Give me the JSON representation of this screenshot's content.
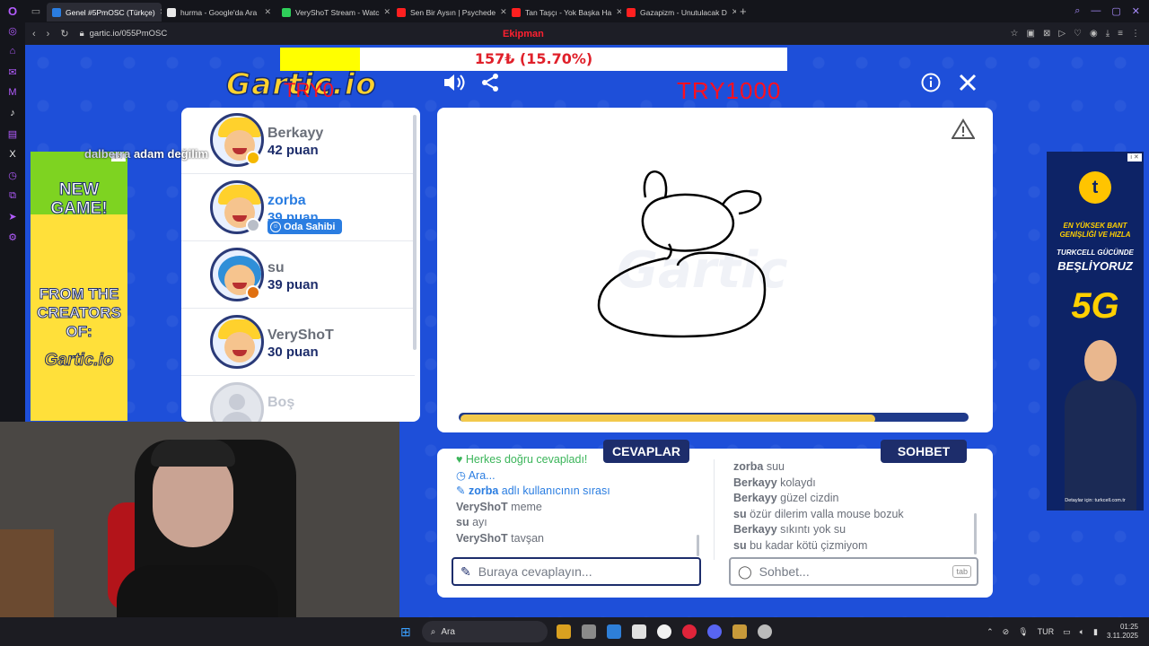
{
  "browser": {
    "tabs": [
      {
        "title": "Genel #5PmOSC (Türkçe)",
        "active": true,
        "color": "#2a7de1"
      },
      {
        "title": "hurma - Google'da Ara",
        "active": false,
        "color": "#e8e8e8"
      },
      {
        "title": "VeryShoT Stream - Watc",
        "active": false,
        "color": "#2fd05a"
      },
      {
        "title": "Sen Bir Aysın | Psychede",
        "active": false,
        "color": "#ff2020"
      },
      {
        "title": "Tan Taşçı - Yok Başka Ha",
        "active": false,
        "color": "#ff2020"
      },
      {
        "title": "Gazapizm - Unutulacak D",
        "active": false,
        "color": "#ff2020"
      }
    ],
    "url": "gartic.io/055PmOSC"
  },
  "overlay": {
    "title": "Ekipman",
    "donation_text": "157₺ (15.70%)",
    "donation_progress": 0.157,
    "logo_overlay": "TRY0",
    "goal_text": "TRY1000",
    "chat_overlay_user": "dalberra",
    "chat_overlay_text": "adam değilim"
  },
  "game": {
    "logo": "Gartic.io",
    "players": [
      {
        "name": "Berkayy",
        "score": "42 puan",
        "dot": "#f5b800"
      },
      {
        "name": "zorba",
        "score": "39 puan",
        "dot": "#b9bec8",
        "owner": "Oda Sahibi",
        "highlight": true
      },
      {
        "name": "su",
        "score": "39 puan",
        "dot": "#e07010"
      },
      {
        "name": "VeryShoT",
        "score": "30 puan",
        "dot": ""
      },
      {
        "name": "Boş",
        "score": "",
        "empty": true
      }
    ],
    "timer_progress": 0.82,
    "tabs": {
      "answers": "CEVAPLAR",
      "chat": "SOHBET"
    },
    "answers": [
      {
        "type": "sys-green",
        "text": "Herkes doğru cevapladı!"
      },
      {
        "type": "sys-blue",
        "text": "Ara..."
      },
      {
        "type": "turn",
        "name": "zorba",
        "text": "adlı kullanıcının sırası"
      },
      {
        "name": "VeryShoT",
        "text": "meme"
      },
      {
        "name": "su",
        "text": "ayı"
      },
      {
        "name": "VeryShoT",
        "text": "tavşan"
      }
    ],
    "chat": [
      {
        "name": "zorba",
        "text": "suu"
      },
      {
        "name": "Berkayy",
        "text": "kolaydı"
      },
      {
        "name": "Berkayy",
        "text": "güzel cizdin"
      },
      {
        "name": "su",
        "text": "özür dilerim valla mouse bozuk"
      },
      {
        "name": "Berkayy",
        "text": "sıkıntı yok su"
      },
      {
        "name": "su",
        "text": "bu kadar kötü çizmiyom"
      }
    ],
    "answer_placeholder": "Buraya cevaplayın...",
    "chat_placeholder": "Sohbet...",
    "chat_hint": "tab"
  },
  "ads": {
    "left": {
      "line1": "NEW GAME!",
      "line2": "FROM THE CREATORS OF:",
      "line3": "Gartic.io"
    },
    "right": {
      "brand": "t",
      "line1": "EN YÜKSEK BANT GENİŞLİĞİ VE HIZLA",
      "line2": "TURKCELL GÜCÜNDE",
      "line3": "BEŞLİYORUZ",
      "line4": "5G",
      "footer": "Detaylar için: turkcell.com.tr"
    }
  },
  "taskbar": {
    "search": "Ara",
    "lang": "TUR",
    "time": "01:25",
    "date": "3.11.2025"
  }
}
